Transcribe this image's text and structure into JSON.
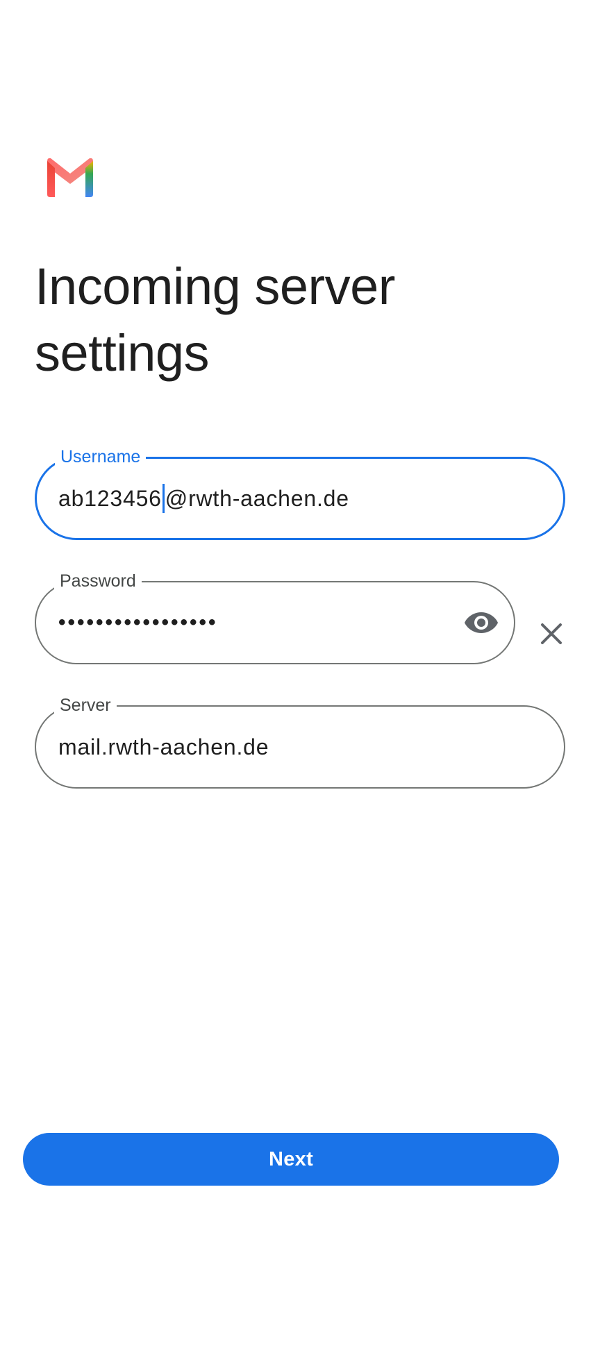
{
  "app": {
    "logo_icon": "gmail-logo-icon"
  },
  "header": {
    "title": "Incoming server settings"
  },
  "form": {
    "username": {
      "label": "Username",
      "value_before_caret": "ab123456",
      "value_after_caret": "@rwth-aachen.de",
      "focused": true
    },
    "password": {
      "label": "Password",
      "masked_value": "•••••••••••••••••",
      "toggle_icon": "eye-icon",
      "clear_icon": "close-icon"
    },
    "server": {
      "label": "Server",
      "value": "mail.rwth-aachen.de"
    }
  },
  "actions": {
    "next_label": "Next"
  },
  "colors": {
    "accent": "#1a73e8",
    "outline": "#747775",
    "text": "#1f1f1f",
    "label": "#444746"
  }
}
